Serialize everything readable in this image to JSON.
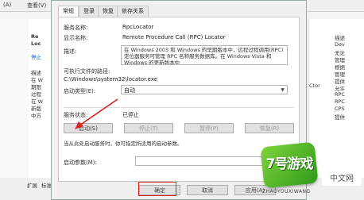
{
  "background": {
    "menu": [
      "(A)",
      "查看(V)"
    ],
    "left_items": [
      "Re",
      "Loc",
      "停止",
      "描述",
      "在 W",
      "期限",
      "过程",
      "在 W",
      "新版",
      "中方"
    ],
    "right_items": [
      "描述",
      "Dev",
      "无论",
      "管理",
      "根据",
      "管理",
      "提供",
      "允许",
      "RPC",
      "RPC",
      "CPS",
      "Ctor",
      "提供"
    ],
    "bottom_tabs": [
      "扩展",
      "标准"
    ]
  },
  "dialog": {
    "tabs": [
      "常规",
      "登录",
      "恢复",
      "依存关系"
    ],
    "service_name_label": "服务名称:",
    "service_name": "RpcLocator",
    "display_name_label": "显示名称:",
    "display_name": "Remote Procedure Call (RPC) Locator",
    "description_label": "描述:",
    "description": "在 Windows 2003 和 Windows 的早期版本中，远程过程调用(RPC)定位器服务可管理 RPC 名称服务数据库。在 Windows Vista 和 Windows 的更新版本中",
    "exe_path_label": "可执行文件的路径:",
    "exe_path": "C:\\Windows\\system32\\locator.exe",
    "startup_type_label": "启动类型(E):",
    "startup_type": "自动",
    "service_status_label": "服务状态:",
    "service_status": "已停止",
    "buttons": {
      "start": "启动(S)",
      "stop": "停止(T)",
      "pause": "暂停(P)",
      "resume": "恢复(R)"
    },
    "hint": "当从此处启动服务时，你可指定所适用的启动参数。",
    "start_params_label": "启动参数(M):",
    "start_params_value": "",
    "ok": "确定",
    "cancel": "取消",
    "apply": "应用(A)"
  },
  "watermark": {
    "logo_text": "7号游戏",
    "sub": "ZHAOYOUXIWANG",
    "corner": "中文网"
  },
  "colors": {
    "highlight": "#dd2222",
    "watermark_green": "#4cb52a"
  }
}
